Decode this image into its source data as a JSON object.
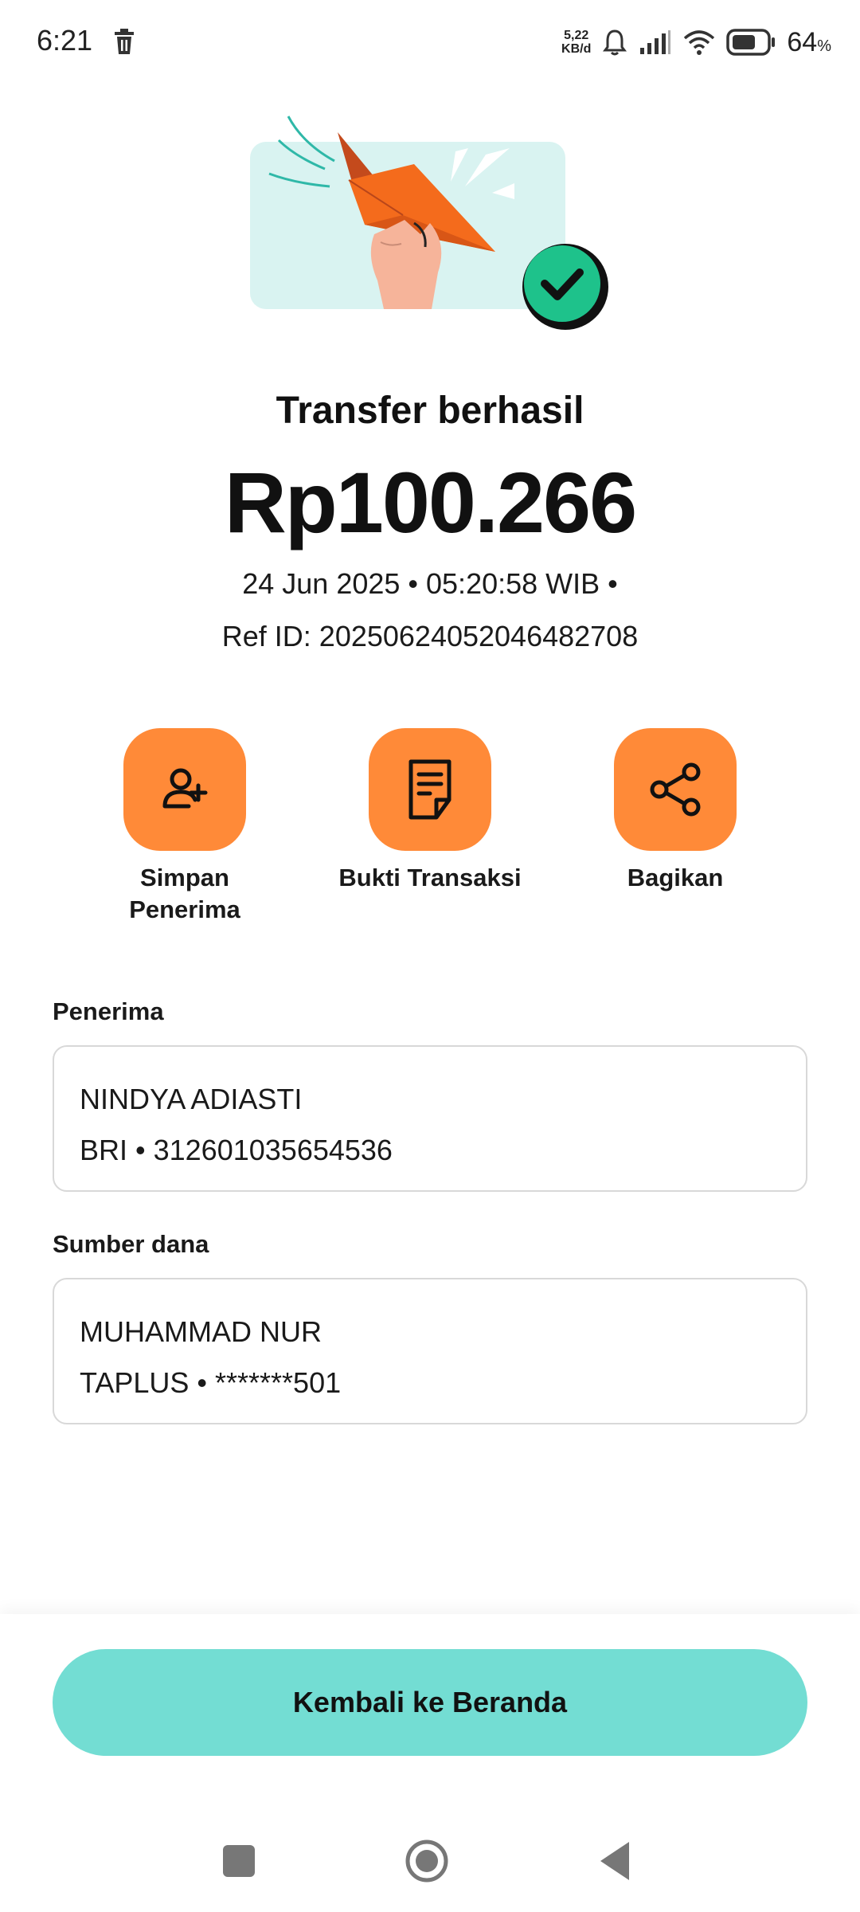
{
  "status": {
    "time": "6:21",
    "netspeed_value": "5,22",
    "netspeed_unit": "KB/d",
    "battery": "64",
    "battery_unit": "%"
  },
  "receipt": {
    "title": "Transfer berhasil",
    "amount": "Rp100.266",
    "datetime": "24 Jun 2025 • 05:20:58 WIB •",
    "ref": "Ref ID: 20250624052046482708"
  },
  "actions": [
    {
      "label": "Simpan Penerima",
      "icon": "add-user-icon"
    },
    {
      "label": "Bukti Transaksi",
      "icon": "receipt-icon"
    },
    {
      "label": "Bagikan",
      "icon": "share-icon"
    }
  ],
  "recipient": {
    "label": "Penerima",
    "name": "NINDYA ADIASTI",
    "account": "BRI • 312601035654536"
  },
  "source": {
    "label": "Sumber dana",
    "name": "MUHAMMAD NUR",
    "account": "TAPLUS • *******501"
  },
  "home_button": "Kembali ke Beranda",
  "colors": {
    "accent_orange": "#ff8a38",
    "button_teal": "#73ddd3",
    "success_green": "#1ec28b"
  }
}
